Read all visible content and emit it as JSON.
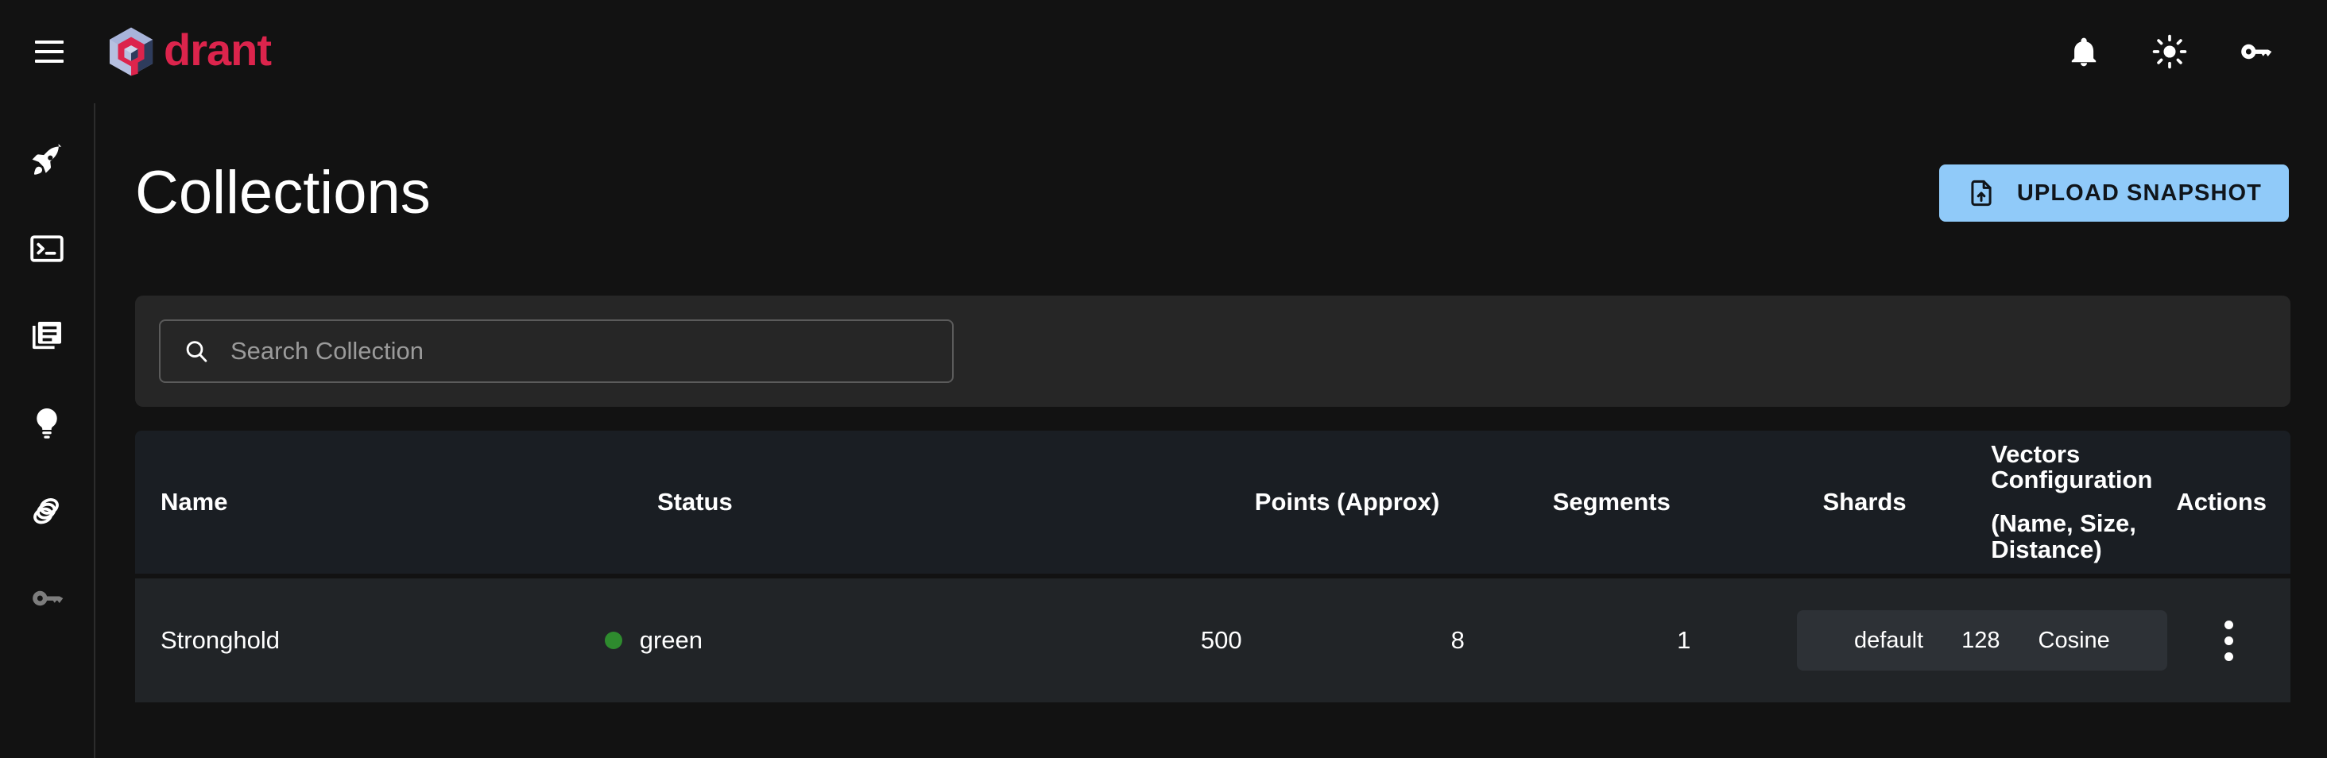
{
  "topbar": {
    "menu_icon": "hamburger-icon",
    "brand_name": "drant",
    "brand_logo": "qdrant-logo-icon",
    "actions": [
      {
        "icon": "bell-icon",
        "name": "notifications"
      },
      {
        "icon": "sun-icon",
        "name": "theme-toggle"
      },
      {
        "icon": "key-icon",
        "name": "api-key"
      }
    ]
  },
  "sidebar": {
    "items": [
      {
        "icon": "rocket-icon",
        "name": "welcome"
      },
      {
        "icon": "console-icon",
        "name": "console"
      },
      {
        "icon": "collections-icon",
        "name": "collections"
      },
      {
        "icon": "lightbulb-icon",
        "name": "tutorial"
      },
      {
        "icon": "datasets-icon",
        "name": "datasets"
      },
      {
        "icon": "key-icon",
        "name": "access-keys"
      }
    ]
  },
  "page": {
    "title": "Collections",
    "upload_label": "UPLOAD SNAPSHOT",
    "upload_icon": "file-upload-icon"
  },
  "search": {
    "placeholder": "Search Collection",
    "value": "",
    "icon": "search-icon"
  },
  "table": {
    "headers": {
      "name": "Name",
      "status": "Status",
      "points": "Points (Approx)",
      "segments": "Segments",
      "shards": "Shards",
      "vectors_line1": "Vectors Configuration",
      "vectors_line2": "(Name, Size, Distance)",
      "actions": "Actions"
    },
    "rows": [
      {
        "name": "Stronghold",
        "status": "green",
        "status_color": "#2e8b2e",
        "points": "500",
        "segments": "8",
        "shards": "1",
        "vector_name": "default",
        "vector_size": "128",
        "vector_distance": "Cosine",
        "actions_icon": "kebab-menu-icon"
      }
    ]
  },
  "colors": {
    "page_bg": "#121212",
    "panel_bg": "#262626",
    "header_bg": "#1a1e23",
    "row_bg": "#212427",
    "chip_bg": "#2d3136",
    "accent": "#dc244c",
    "button_bg": "#90caf9"
  }
}
